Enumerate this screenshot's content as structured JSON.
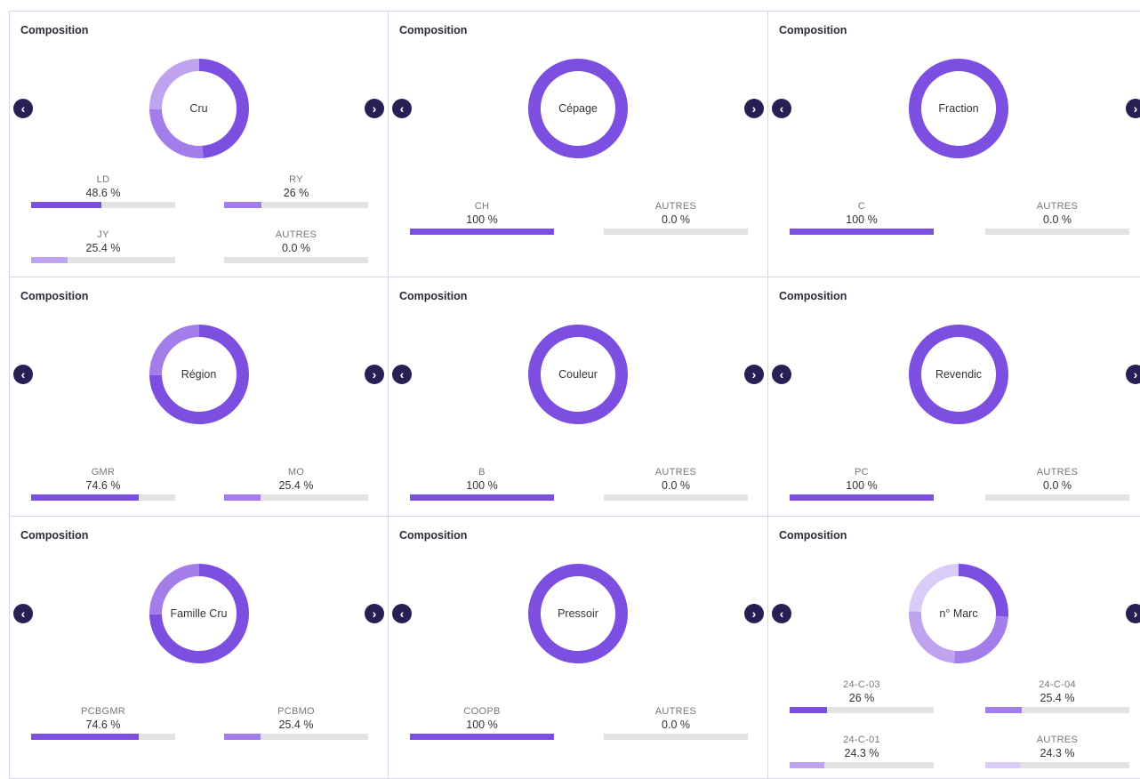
{
  "colors": {
    "c1": "#7c4fe0",
    "c2": "#a37dea",
    "c3": "#bfa3ef",
    "c4": "#d9ccf6",
    "track": "#e3e3e6",
    "nav": "#2a1f55"
  },
  "cards": [
    {
      "title": "Composition",
      "center": "Cru",
      "items": [
        {
          "label": "LD",
          "value": "48.6 %",
          "fraction": 0.486
        },
        {
          "label": "RY",
          "value": "26 %",
          "fraction": 0.26
        },
        {
          "label": "JY",
          "value": "25.4 %",
          "fraction": 0.254
        },
        {
          "label": "AUTRES",
          "value": "0.0 %",
          "fraction": 0
        }
      ]
    },
    {
      "title": "Composition",
      "center": "Cépage",
      "items": [
        {
          "label": "CH",
          "value": "100 %",
          "fraction": 1
        },
        {
          "label": "AUTRES",
          "value": "0.0 %",
          "fraction": 0
        }
      ]
    },
    {
      "title": "Composition",
      "center": "Fraction",
      "items": [
        {
          "label": "C",
          "value": "100 %",
          "fraction": 1
        },
        {
          "label": "AUTRES",
          "value": "0.0 %",
          "fraction": 0
        }
      ]
    },
    {
      "title": "Composition",
      "center": "Région",
      "items": [
        {
          "label": "GMR",
          "value": "74.6 %",
          "fraction": 0.746
        },
        {
          "label": "MO",
          "value": "25.4 %",
          "fraction": 0.254
        }
      ]
    },
    {
      "title": "Composition",
      "center": "Couleur",
      "items": [
        {
          "label": "B",
          "value": "100 %",
          "fraction": 1
        },
        {
          "label": "AUTRES",
          "value": "0.0 %",
          "fraction": 0
        }
      ]
    },
    {
      "title": "Composition",
      "center": "Revendic",
      "items": [
        {
          "label": "PC",
          "value": "100 %",
          "fraction": 1
        },
        {
          "label": "AUTRES",
          "value": "0.0 %",
          "fraction": 0
        }
      ]
    },
    {
      "title": "Composition",
      "center": "Famille Cru",
      "items": [
        {
          "label": "PCBGMR",
          "value": "74.6 %",
          "fraction": 0.746
        },
        {
          "label": "PCBMO",
          "value": "25.4 %",
          "fraction": 0.254
        }
      ]
    },
    {
      "title": "Composition",
      "center": "Pressoir",
      "items": [
        {
          "label": "COOPB",
          "value": "100 %",
          "fraction": 1
        },
        {
          "label": "AUTRES",
          "value": "0.0 %",
          "fraction": 0
        }
      ]
    },
    {
      "title": "Composition",
      "center": "n° Marc",
      "items": [
        {
          "label": "24-C-03",
          "value": "26 %",
          "fraction": 0.26
        },
        {
          "label": "24-C-04",
          "value": "25.4 %",
          "fraction": 0.254
        },
        {
          "label": "24-C-01",
          "value": "24.3 %",
          "fraction": 0.243
        },
        {
          "label": "AUTRES",
          "value": "24.3 %",
          "fraction": 0.243
        }
      ]
    }
  ]
}
